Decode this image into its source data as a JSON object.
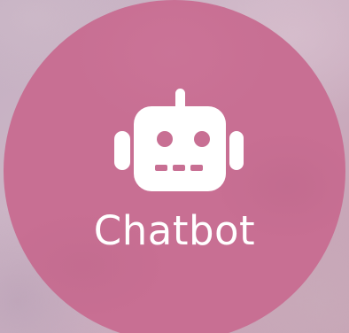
{
  "app": {
    "label": "Chatbot",
    "icon": "robot-icon",
    "tile_color": "#c86f93",
    "icon_color": "#ffffff"
  }
}
